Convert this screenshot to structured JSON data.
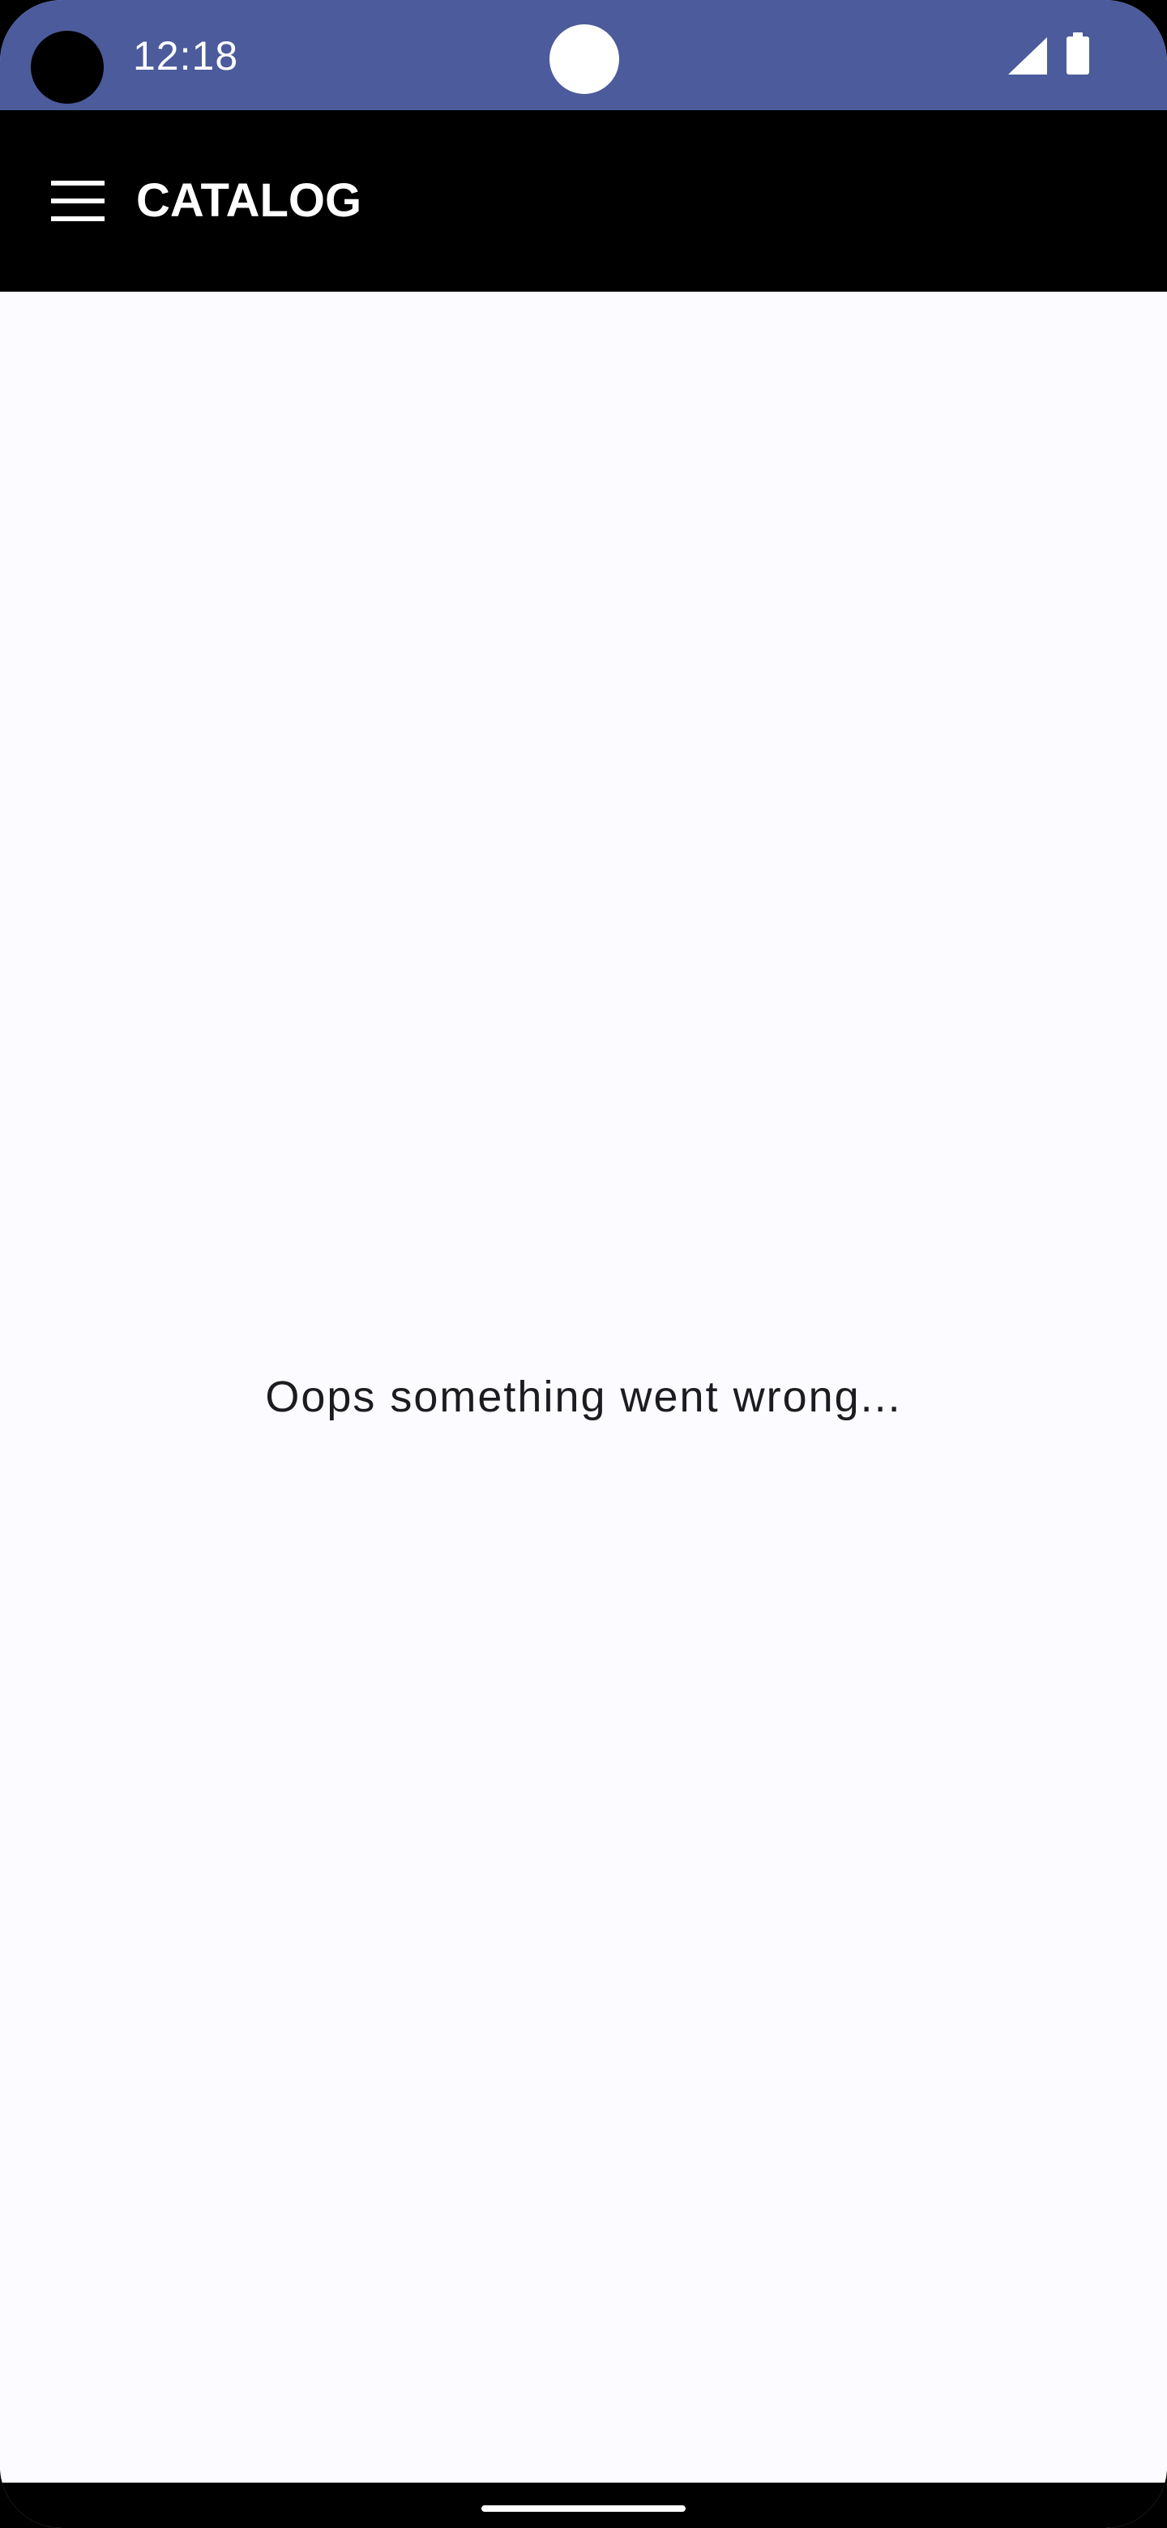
{
  "status_bar": {
    "time": "12:18",
    "background_color": "#4b5b9b",
    "icons": [
      "camera-cutout",
      "signal-icon",
      "battery-icon"
    ]
  },
  "app_bar": {
    "title": "CATALOG",
    "menu_icon": "hamburger-menu-icon",
    "background_color": "#000000"
  },
  "content": {
    "error_message": "Oops something went wrong...",
    "background_color": "#fcfbff"
  },
  "nav_bar": {
    "handle": "home-gesture-handle"
  }
}
